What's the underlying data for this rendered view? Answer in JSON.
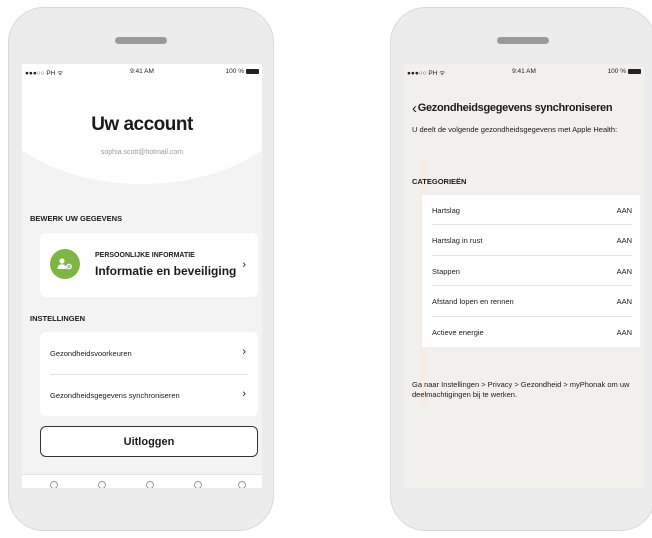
{
  "left_screen": {
    "status_bar": {
      "carrier": "●●●○○ PH ᯤ",
      "time": "9:41 AM",
      "battery": "100 %"
    },
    "title": "Uw account",
    "email": "sophia.scott@hotmail.com",
    "edit_section": {
      "label": "BEWERK UW GEGEVENS",
      "card": {
        "title": "PERSOONLIJKE INFORMATIE",
        "subtitle": "Informatie en beveiliging"
      }
    },
    "settings_section": {
      "label": "INSTELLINGEN",
      "items": [
        {
          "label": "Gezondheidsvoorkeuren"
        },
        {
          "label": "Gezondheidsgegevens synchroniseren"
        }
      ]
    },
    "logout_label": "Uitloggen",
    "accent_color": "#7fb542"
  },
  "right_screen": {
    "status_bar": {
      "carrier": "●●●○○ PH ᯤ",
      "time": "9:41 AM",
      "battery": "100 %"
    },
    "title": "Gezondheidsgegevens synchroniseren",
    "description": "U deelt de volgende gezondheidsgegevens met Apple Health:",
    "categories_label": "CATEGORIEËN",
    "categories": [
      {
        "label": "Hartslag",
        "value": "AAN"
      },
      {
        "label": "Hartslag in rust",
        "value": "AAN"
      },
      {
        "label": "Stappen",
        "value": "AAN"
      },
      {
        "label": "Afstand lopen en rennen",
        "value": "AAN"
      },
      {
        "label": "Actieve energie",
        "value": "AAN"
      }
    ],
    "footer": "Ga naar Instellingen > Privacy > Gezondheid > myPhonak om uw deelmachtigingen bij te werken."
  }
}
